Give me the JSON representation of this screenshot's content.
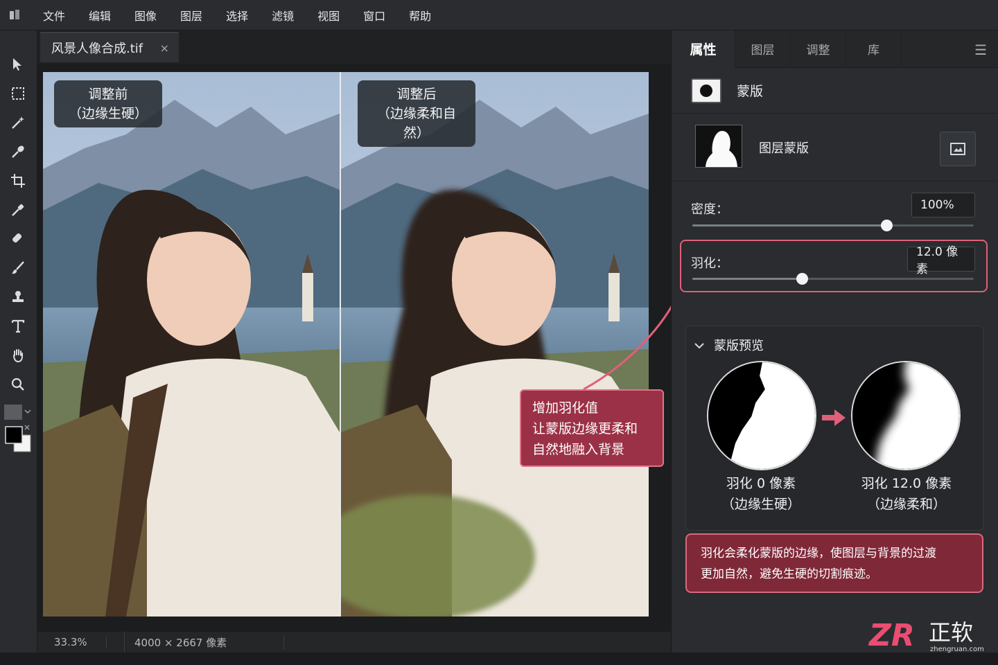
{
  "menu": {
    "items": [
      "文件",
      "编辑",
      "图像",
      "图层",
      "选择",
      "滤镜",
      "视图",
      "窗口",
      "帮助"
    ]
  },
  "tools": [
    "move-icon",
    "marquee-icon",
    "magic-wand-icon",
    "quick-select-icon",
    "crop-icon",
    "eyedropper-icon",
    "healing-brush-icon",
    "brush-icon",
    "stamp-icon",
    "type-icon",
    "hand-icon",
    "zoom-icon"
  ],
  "document": {
    "tab_title": "风景人像合成.tif",
    "close_glyph": "×"
  },
  "canvas": {
    "label_before_line1": "调整前",
    "label_before_line2": "（边缘生硬）",
    "label_after_line1": "调整后",
    "label_after_line2": "（边缘柔和自然）",
    "callout_line1": "增加羽化值",
    "callout_line2": "让蒙版边缘更柔和",
    "callout_line3": "自然地融入背景"
  },
  "status": {
    "zoom": "33.3%",
    "doc_size": "4000 × 2667 像素"
  },
  "panel": {
    "tabs": [
      "属性",
      "图层",
      "调整",
      "库"
    ],
    "active_tab": "属性",
    "section_title": "蒙版",
    "layer_mask_label": "图层蒙版",
    "density_label": "密度：",
    "density_value": "100%",
    "density_level": 0.69,
    "feather_label": "羽化：",
    "feather_value": "12.0 像素",
    "feather_level": 0.39,
    "preview_title": "蒙版预览",
    "preview_left_line1": "羽化 0 像素",
    "preview_left_line2": "（边缘生硬）",
    "preview_right_line1": "羽化 12.0 像素",
    "preview_right_line2": "（边缘柔和）",
    "note_line1": "羽化会柔化蒙版的边缘，使图层与背景的过渡",
    "note_line2": "更加自然，避免生硬的切割痕迹。"
  },
  "watermark": {
    "logo_text": "ZR",
    "cn_text": "正软",
    "url": "zhengruan.com"
  },
  "colors": {
    "accent": "#e0607a",
    "callout_bg": "#9b3146",
    "note_bg": "#7f2838"
  }
}
